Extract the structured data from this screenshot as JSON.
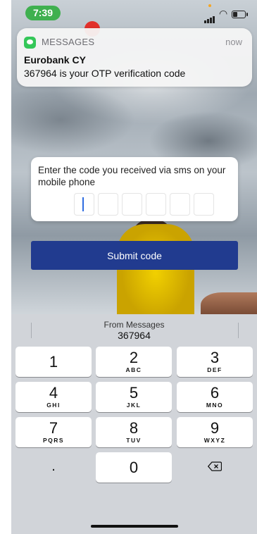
{
  "status_bar": {
    "time": "7:39"
  },
  "notification": {
    "app": "MESSAGES",
    "time": "now",
    "sender": "Eurobank CY",
    "message": "367964 is your OTP verification code"
  },
  "otp": {
    "prompt": "Enter the code you received via sms on your mobile phone",
    "box_count": 6,
    "submit_label": "Submit code"
  },
  "keyboard": {
    "suggestion_source": "From Messages",
    "suggestion_code": "367964",
    "keys": [
      {
        "num": "1",
        "letters": ""
      },
      {
        "num": "2",
        "letters": "ABC"
      },
      {
        "num": "3",
        "letters": "DEF"
      },
      {
        "num": "4",
        "letters": "GHI"
      },
      {
        "num": "5",
        "letters": "JKL"
      },
      {
        "num": "6",
        "letters": "MNO"
      },
      {
        "num": "7",
        "letters": "PQRS"
      },
      {
        "num": "8",
        "letters": "TUV"
      },
      {
        "num": "9",
        "letters": "WXYZ"
      },
      {
        "num": ".",
        "letters": ""
      },
      {
        "num": "0",
        "letters": ""
      }
    ]
  },
  "colors": {
    "accent": "#213b8f",
    "messages_green": "#34c759",
    "cursor": "#2f6de1"
  }
}
